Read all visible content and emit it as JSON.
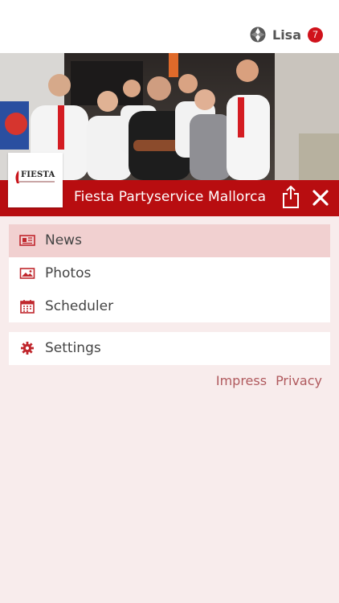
{
  "header": {
    "user_name": "Lisa",
    "notification_count": "7"
  },
  "brand": {
    "title": "Fiesta Partyservice Mallorca",
    "logo_text": "FIESTA",
    "accent_color": "#b80d10"
  },
  "menu": {
    "primary": [
      {
        "label": "News",
        "icon": "newspaper-icon",
        "active": true
      },
      {
        "label": "Photos",
        "icon": "image-icon",
        "active": false
      },
      {
        "label": "Scheduler",
        "icon": "calendar-icon",
        "active": false
      }
    ],
    "secondary": [
      {
        "label": "Settings",
        "icon": "gear-icon",
        "active": false
      }
    ]
  },
  "footer": {
    "impress_label": "Impress",
    "privacy_label": "Privacy"
  }
}
